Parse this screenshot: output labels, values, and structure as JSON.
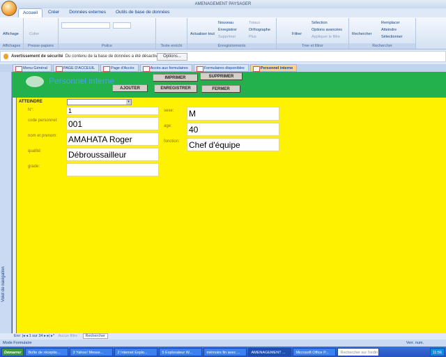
{
  "window": {
    "title": "AMENAGEMENT PAYSAGER"
  },
  "ribbon": {
    "tabs": [
      "Accueil",
      "Créer",
      "Données externes",
      "Outils de base de données"
    ],
    "groups": [
      "Affichages",
      "Presse-papiers",
      "Police",
      "Texte enrichi",
      "Enregistrements",
      "Trier et filtrer",
      "Rechercher"
    ],
    "buttons": {
      "affichage": "Affichage",
      "coller": "Coller",
      "actualiser": "Actualiser tout",
      "nouveau": "Nouveau",
      "enregistrer": "Enregistrer",
      "supprimer": "Supprimer",
      "totaux": "Totaux",
      "orthographe": "Orthographe",
      "plus": "Plus",
      "filtrer": "Filtrer",
      "selection": "Sélection",
      "options_avancees": "Options avancées",
      "appliquer_filtre": "Appliquer le filtre",
      "rechercher": "Rechercher",
      "remplacer": "Remplacer",
      "atteindre": "Atteindre",
      "selectionner": "Sélectionner"
    }
  },
  "security": {
    "title": "Avertissement de sécurité",
    "message": "Du contenu de la base de données a été désactivé",
    "options": "Options..."
  },
  "doc_tabs": [
    "Menu Général",
    "PAGE D'ACCEUIL",
    "Page d'Accès",
    "Accès aux formulaires",
    "Formulaires disponibles",
    "Personnel interne"
  ],
  "nav_pane": "Volet de navigation",
  "form": {
    "title": "Personnel interne",
    "buttons": {
      "imprimer": "IMPRIMER",
      "supprimer": "SUPPRIMER",
      "ajouter": "AJOUTER",
      "enregistrer": "ENREGISTRER",
      "fermer": "FERMER"
    },
    "atteindre": "ATTEINDRE",
    "fields": {
      "num": {
        "label": "N°:",
        "value": "1"
      },
      "code": {
        "label": "code personnel:",
        "value": "001"
      },
      "nom": {
        "label": "nom et prenom:",
        "value": "AMAHATA Roger"
      },
      "qualite": {
        "label": "qualité:",
        "value": "Débroussailleur"
      },
      "grade": {
        "label": "grade:",
        "value": ""
      },
      "sexe": {
        "label": "sexe:",
        "value": "M"
      },
      "age": {
        "label": "age:",
        "value": "40"
      },
      "fonction": {
        "label": "fonction:",
        "value": "Chef d'équipe"
      }
    }
  },
  "record_nav": {
    "label": "Enr:",
    "position": "1 sur 34",
    "filter": "Aucun filtre",
    "search": "Rechercher"
  },
  "status": {
    "mode": "Mode Formulaire",
    "num": "Verr. num."
  },
  "taskbar": {
    "start": "Démarrer",
    "items": [
      "Boîte de réceptio...",
      "3 Yahoo! Messe...",
      "2 Internet Explo...",
      "5 Explorateur W...",
      "mémoire fin avec ...",
      "AMENAGEMENT ...",
      "Microsoft Office P..."
    ],
    "search": "Rechercher sur l'ordin",
    "clock": "11:56"
  }
}
